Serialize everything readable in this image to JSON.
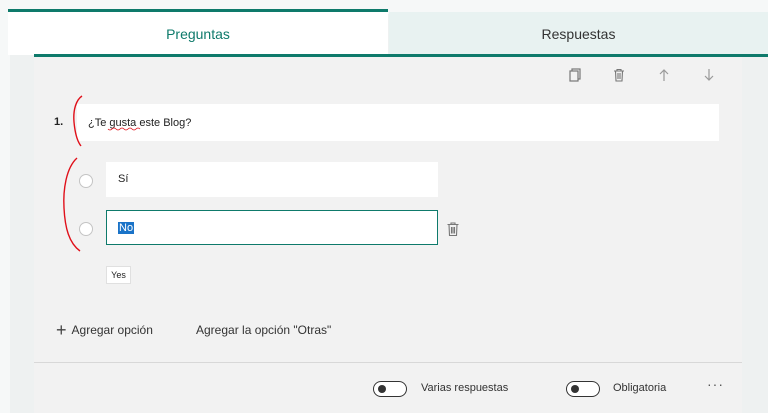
{
  "tabs": {
    "questions": "Preguntas",
    "responses": "Respuestas"
  },
  "toolbar": {
    "copy_icon": "copy-icon",
    "delete_icon": "trash-icon",
    "up_icon": "arrow-up-icon",
    "down_icon": "arrow-down-icon"
  },
  "question": {
    "number": "1.",
    "text": "¿Te gusta este Blog?",
    "options": [
      "Sí",
      "No"
    ],
    "suggestion": "Yes"
  },
  "actions": {
    "add_option": "Agregar opción",
    "add_other": "Agregar la opción \"Otras\""
  },
  "footer": {
    "multiple": "Varias respuestas",
    "required": "Obligatoria",
    "more": "···"
  },
  "colors": {
    "accent": "#0e7a6b",
    "selection": "#1a73c8",
    "annotation": "#e0101a"
  }
}
